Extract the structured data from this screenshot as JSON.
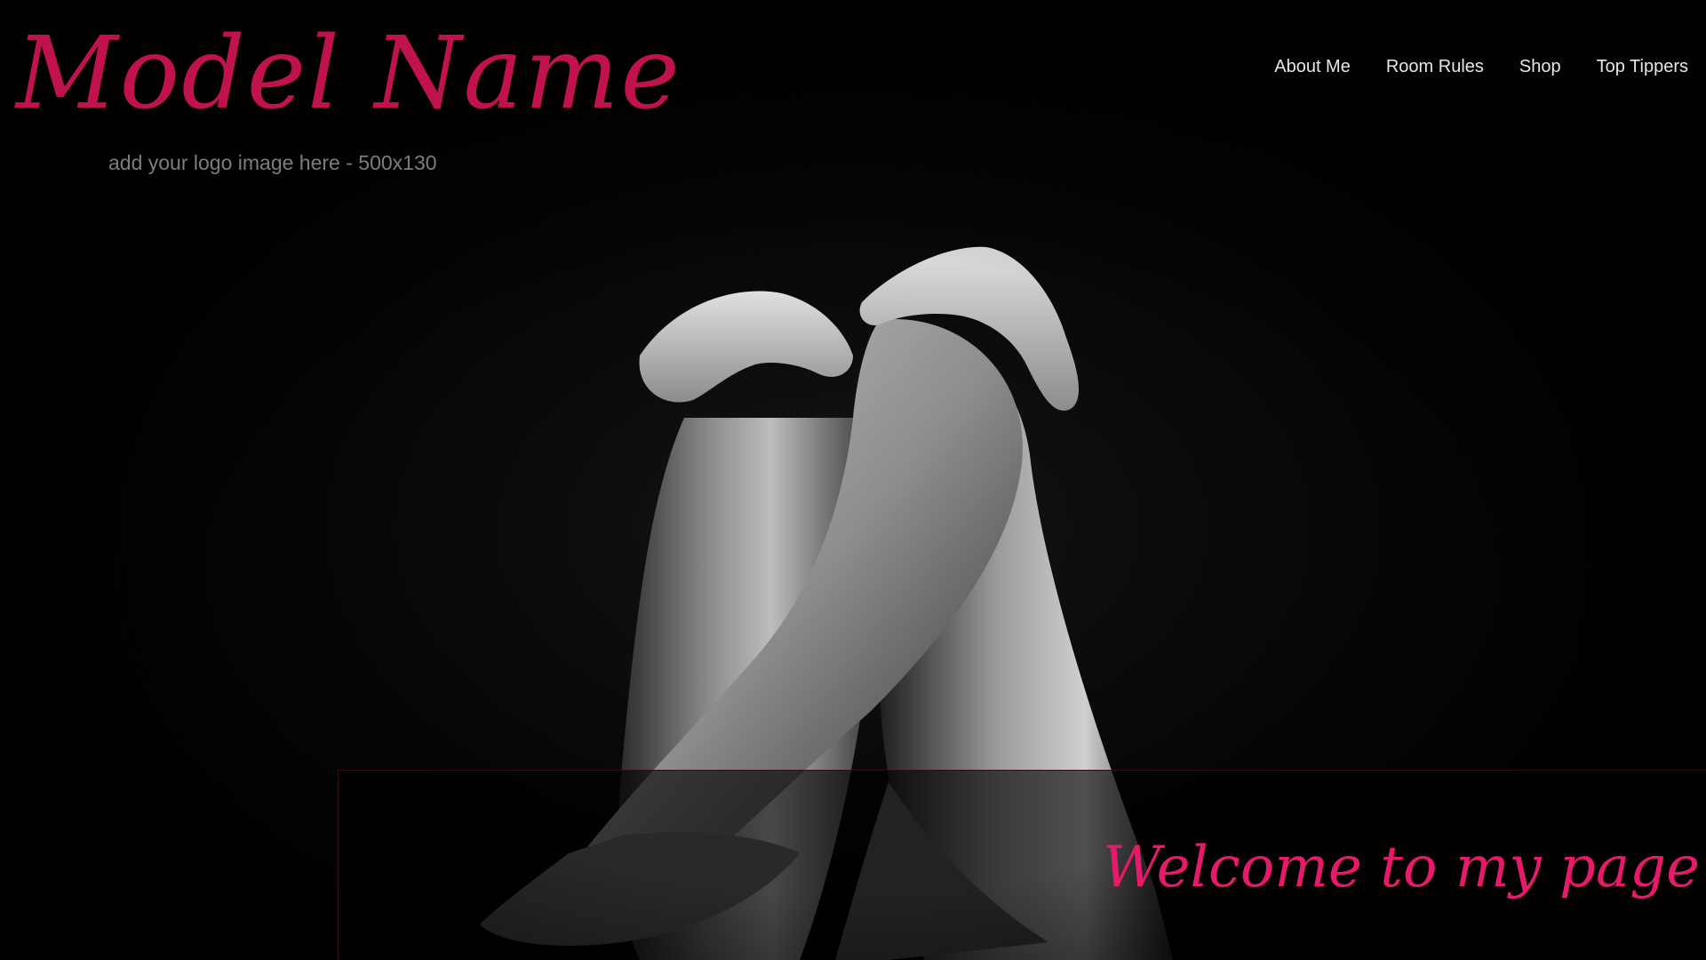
{
  "logo": {
    "title": "Model Name",
    "subtitle": "add your logo image here - 500x130"
  },
  "nav": {
    "items": [
      {
        "label": "About Me"
      },
      {
        "label": "Room Rules"
      },
      {
        "label": "Shop"
      },
      {
        "label": "Top Tippers"
      }
    ]
  },
  "hero": {
    "image": "black-and-white-photo-crossed-legs-hands-on-knees"
  },
  "welcome": {
    "text": "Welcome to my page"
  },
  "colors": {
    "background": "#000000",
    "brand": "#c0124f",
    "welcome": "#e51a6b",
    "nav_text": "#e6e6e6",
    "subtitle": "#7d7d7d"
  }
}
